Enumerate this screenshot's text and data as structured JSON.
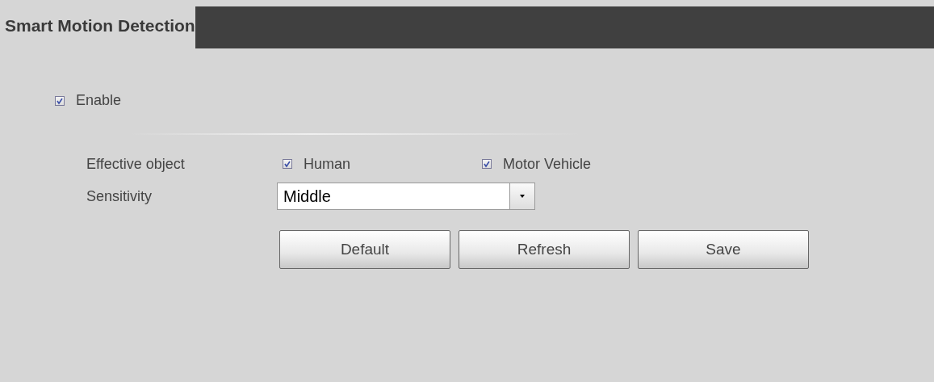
{
  "title": "Smart Motion Detection",
  "enable": {
    "label": "Enable",
    "checked": true
  },
  "effective_object": {
    "label": "Effective object",
    "options": [
      {
        "label": "Human",
        "checked": true
      },
      {
        "label": "Motor Vehicle",
        "checked": true
      }
    ]
  },
  "sensitivity": {
    "label": "Sensitivity",
    "value": "Middle"
  },
  "buttons": [
    "Default",
    "Refresh",
    "Save"
  ]
}
